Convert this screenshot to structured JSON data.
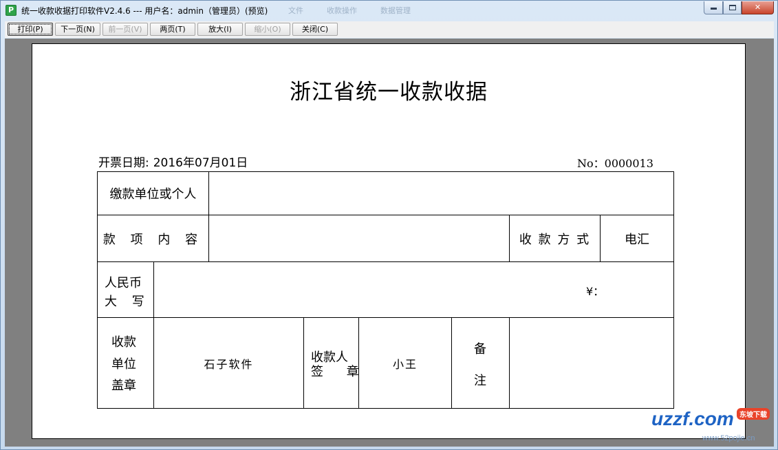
{
  "window": {
    "title": "统一收款收据打印软件V2.4.6 --- 用户名：admin（管理员）(预览)",
    "icon_letter": "P",
    "ghost_menu": [
      "文件",
      "收款操作",
      "数据管理"
    ]
  },
  "toolbar": {
    "print": "打印(P)",
    "next_page": "下一页(N)",
    "prev_page": "前一页(V)",
    "two_pages": "两页(T)",
    "zoom_in": "放大(I)",
    "zoom_out": "缩小(O)",
    "close": "关闭(C)"
  },
  "receipt": {
    "title": "浙江省统一收款收据",
    "date_label": "开票日期:",
    "date_value": "2016年07月01日",
    "no_label": "No：",
    "no_value": "0000013",
    "payer_label": "缴款单位或个人",
    "payer_value": "",
    "item_label": "款 项 内 容",
    "item_value": "",
    "method_label": "收 款 方 式",
    "method_value": "电汇",
    "rmb_label_1": "人民币",
    "rmb_label_2": "大 写",
    "rmb_value": "",
    "yen": "¥：",
    "unit_label_1": "收款",
    "unit_label_2": "单位",
    "unit_label_3": "盖章",
    "unit_value": "石子软件",
    "payee_label_1": "收款人",
    "payee_label_2": "签 章",
    "payee_value": "小王",
    "remark_1": "备",
    "remark_2": "注",
    "remark_value": ""
  },
  "watermark": {
    "logo": "uzzf.com",
    "badge": "东坡下载",
    "site": "www.52pojie.cn"
  }
}
